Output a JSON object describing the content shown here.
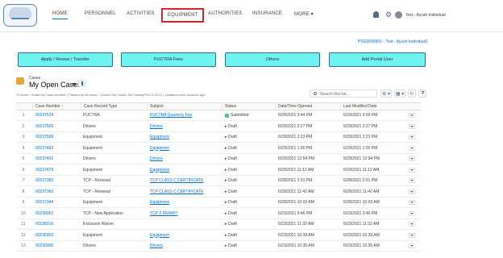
{
  "header": {
    "nav": [
      "HOME",
      "PERSONNEL",
      "ACTIVITIES",
      "EQUIPMENT",
      "AUTHORITIES",
      "INSURANCE",
      "MORE ▾"
    ],
    "user": "Test - Ayush Individual"
  },
  "account_id": "PSG0099901 - Test - Ayush Individual1",
  "actions": [
    "Apply / Renew / Transfer",
    "PUCTRA Fees",
    "Others",
    "Add Portal User"
  ],
  "list": {
    "object": "Cases",
    "title": "My Open Cases",
    "meta": "20 items • Sorted by Case Number • Filtered by All cases - Closed, My Cases, My Cases(PSC & VCC) • Updated a few seconds ago",
    "search_placeholder": "Search this list...",
    "tools": [
      "⚙ ▾",
      "▦ ▾",
      "↻",
      "⧩"
    ]
  },
  "columns": [
    "Case Number ↑",
    "Case Record Type",
    "Subject",
    "Status",
    "Date/Time Opened",
    "Last Modified Date"
  ],
  "rows": [
    {
      "n": "1",
      "case": "00237524",
      "type": "PUCTRA",
      "subject": "PUCTRA Quarterly Fee",
      "status": "Submitted",
      "opened": "6/29/2021 3:44 PM",
      "modified": "6/29/2021 3:59 PM"
    },
    {
      "n": "2",
      "case": "00237509",
      "type": "Drivers",
      "subject": "Drivers",
      "status": "Draft",
      "opened": "6/29/2021 2:27 PM",
      "modified": "6/29/2021 2:27 PM"
    },
    {
      "n": "3",
      "case": "00237508",
      "type": "Equipment",
      "subject": "Equipment",
      "status": "Draft",
      "opened": "6/29/2021 2:23 PM",
      "modified": "6/29/2021 2:23 PM"
    },
    {
      "n": "4",
      "case": "00237493",
      "type": "Equipment",
      "subject": "Equipment",
      "status": "Draft",
      "opened": "6/29/2021 1:00 PM",
      "modified": "6/29/2021 1:00 PM"
    },
    {
      "n": "5",
      "case": "00237492",
      "type": "Drivers",
      "subject": "Drivers",
      "status": "Draft",
      "opened": "6/29/2021 12:54 PM",
      "modified": "6/29/2021 12:54 PM"
    },
    {
      "n": "6",
      "case": "00237479",
      "type": "Equipment",
      "subject": "Equipment",
      "status": "Draft",
      "opened": "6/29/2021 11:12 AM",
      "modified": "6/29/2021 11:12 AM"
    },
    {
      "n": "7",
      "case": "00237382",
      "type": "TCP - Renewal",
      "subject": "TCP CLASS C CERTIFICATE",
      "status": "Draft",
      "opened": "6/28/2021 2:01 PM",
      "modified": "6/28/2021 2:01 PM"
    },
    {
      "n": "8",
      "case": "00237360",
      "type": "TCP - Renewal",
      "subject": "TCP CLASS C CERTIFICATE",
      "status": "Draft",
      "opened": "6/28/2021 11:42 AM",
      "modified": "6/28/2021 11:42 AM"
    },
    {
      "n": "9",
      "case": "00237344",
      "type": "Equipment",
      "subject": "Equipment",
      "status": "Draft",
      "opened": "6/28/2021 10:03 AM",
      "modified": "6/28/2021 10:03 AM"
    },
    {
      "n": "10",
      "case": "00236952",
      "type": "TCP - New Application",
      "subject": "TCP Z PERMIT",
      "status": "Draft",
      "opened": "6/23/2021 3:46 PM",
      "modified": "6/23/2021 3:46 PM"
    },
    {
      "n": "11",
      "case": "00236916",
      "type": "Exclusion Waiver",
      "subject": "",
      "status": "Draft",
      "opened": "6/23/2021 11:32 AM",
      "modified": "6/23/2021 11:32 AM"
    },
    {
      "n": "12",
      "case": "00236902",
      "type": "Equipment",
      "subject": "Equipment",
      "status": "Draft",
      "opened": "6/23/2021 10:39 AM",
      "modified": "6/23/2021 10:39 AM"
    },
    {
      "n": "13",
      "case": "00236900",
      "type": "Drivers",
      "subject": "Drivers",
      "status": "Draft",
      "opened": "6/23/2021 10:35 AM",
      "modified": "6/23/2021 10:35 AM"
    }
  ],
  "colors": {
    "accent": "#0070d2",
    "action_button": "#6ff3f1",
    "highlight": "#d8262c"
  }
}
